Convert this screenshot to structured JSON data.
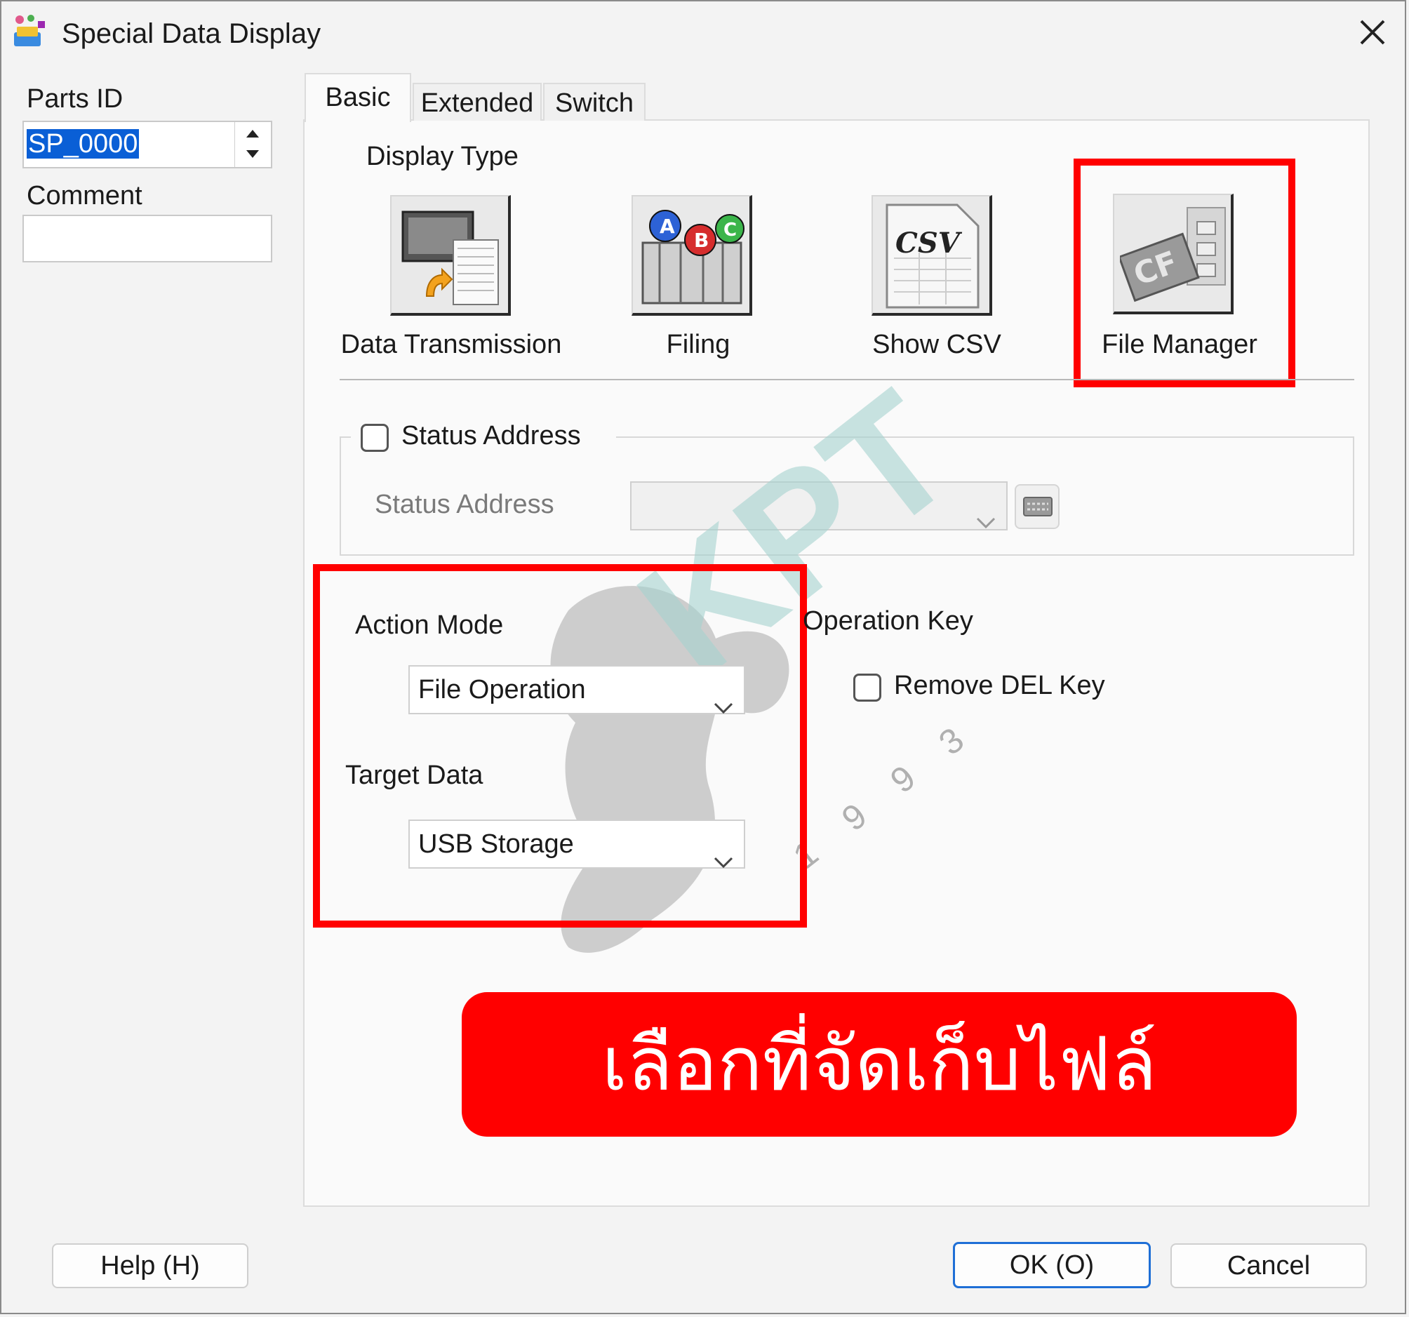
{
  "window": {
    "title": "Special Data Display",
    "app_icon": "gp-pro-app-icon",
    "close_icon": "close-icon"
  },
  "left": {
    "parts_id_label": "Parts ID",
    "parts_id_value": "SP_0000",
    "comment_label": "Comment",
    "comment_value": ""
  },
  "tabs": [
    {
      "label": "Basic",
      "active": true
    },
    {
      "label": "Extended",
      "active": false
    },
    {
      "label": "Switch",
      "active": false
    }
  ],
  "display_type": {
    "label": "Display Type",
    "options": [
      {
        "label": "Data Transmission",
        "icon": "data-transmission-icon"
      },
      {
        "label": "Filing",
        "icon": "filing-abc-icon"
      },
      {
        "label": "Show CSV",
        "icon": "csv-icon",
        "icon_text": "CSV"
      },
      {
        "label": "File Manager",
        "icon": "cf-card-icon",
        "icon_text": "CF",
        "selected": true
      }
    ]
  },
  "status_address": {
    "checkbox_label": "Status Address",
    "checked": false,
    "field_label": "Status Address",
    "value": ""
  },
  "action_mode": {
    "label": "Action Mode",
    "value": "File Operation"
  },
  "target_data": {
    "label": "Target Data",
    "value": "USB Storage"
  },
  "operation_key": {
    "label": "Operation Key",
    "remove_del_label": "Remove DEL Key",
    "remove_del_checked": false
  },
  "annotation": {
    "text": "เลือกที่จัดเก็บไฟล์",
    "color": "#ff0000"
  },
  "watermark": {
    "text": "KPT",
    "digits": "1993"
  },
  "buttons": {
    "help": "Help (H)",
    "ok": "OK (O)",
    "cancel": "Cancel"
  },
  "colors": {
    "highlight": "#ff0000",
    "selection": "#0a5fd6",
    "primary_border": "#1f6fd6"
  }
}
